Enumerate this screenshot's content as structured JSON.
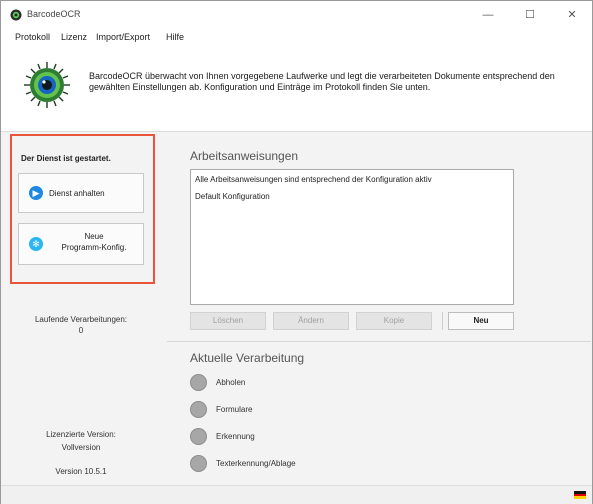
{
  "window": {
    "title": "BarcodeOCR",
    "buttons": {
      "minimize": "—",
      "maximize": "☐",
      "close": "✕"
    }
  },
  "menu": [
    "Protokoll",
    "Lizenz",
    "Import/Export",
    "Hilfe"
  ],
  "header": {
    "description": "BarcodeOCR überwacht von Ihnen vorgegebene Laufwerke und legt die verarbeiteten Dokumente entsprechend den gewählten Einstellungen ab. Konfiguration und Einträge im Protokoll finden Sie unten."
  },
  "left": {
    "title": "Der Dienst ist gestartet.",
    "buttons": {
      "stop_service": "Dienst anhalten",
      "new_config_line1": "Neue",
      "new_config_line2": "Programm-Konfig."
    },
    "info_label": "Laufende Verarbeitungen:",
    "info_value": "0",
    "version_label": "Lizenzierte Version:",
    "version_value": "Vollversion",
    "build": "Version 10.5.1"
  },
  "main": {
    "tasks_title": "Arbeitsanweisungen",
    "tasks_lines": [
      "Alle Arbeitsanweisungen sind entsprechend der Konfiguration aktiv",
      "Default Konfiguration"
    ],
    "buttons": {
      "delete": "Löschen",
      "edit": "Ändern",
      "copy": "Kopie",
      "new": "Neu"
    },
    "status_title": "Aktuelle Verarbeitung",
    "status_items": [
      "Abholen",
      "Formulare",
      "Erkennung",
      "Texterkennung/Ablage"
    ]
  },
  "colors": {
    "accent_border": "#e8553a",
    "play_blue": "#1e88e5",
    "status_dot": "#a7a7a7"
  },
  "icons": {
    "logo": "eye-logo-icon",
    "play": "play-icon",
    "config": "gear-icon",
    "flag": "german-flag-icon"
  }
}
